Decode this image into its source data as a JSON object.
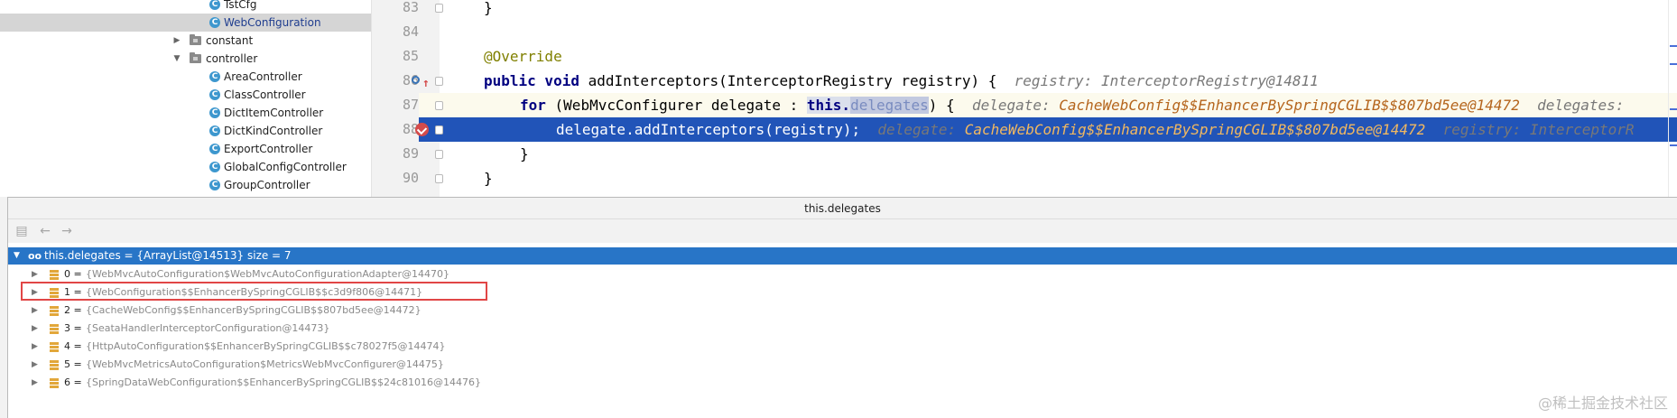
{
  "tree": {
    "items": [
      {
        "label": "TstCfg",
        "type": "class",
        "expanded": null,
        "selected": false
      },
      {
        "label": "WebConfiguration",
        "type": "class",
        "expanded": null,
        "selected": true
      },
      {
        "label": "constant",
        "type": "package",
        "expanded": false,
        "selected": false
      },
      {
        "label": "controller",
        "type": "package",
        "expanded": true,
        "selected": false
      },
      {
        "label": "AreaController",
        "type": "class",
        "expanded": null,
        "selected": false
      },
      {
        "label": "ClassController",
        "type": "class",
        "expanded": null,
        "selected": false
      },
      {
        "label": "DictItemController",
        "type": "class",
        "expanded": null,
        "selected": false
      },
      {
        "label": "DictKindController",
        "type": "class",
        "expanded": null,
        "selected": false
      },
      {
        "label": "ExportController",
        "type": "class",
        "expanded": null,
        "selected": false
      },
      {
        "label": "GlobalConfigController",
        "type": "class",
        "expanded": null,
        "selected": false
      },
      {
        "label": "GroupController",
        "type": "class",
        "expanded": null,
        "selected": false
      }
    ]
  },
  "editor": {
    "lines": [
      {
        "num": "83",
        "code": "}"
      },
      {
        "num": "84",
        "code": ""
      },
      {
        "num": "85",
        "annotation": "@Override"
      },
      {
        "num": "86",
        "kw": "public void",
        "code": " addInterceptors(InterceptorRegistry registry) {",
        "hint_key": "registry:",
        "hint_val": "InterceptorRegistry@14811"
      },
      {
        "num": "87",
        "kw": "for",
        "pre": " (WebMvcConfigurer delegate : ",
        "kw2": "this.",
        "field": "delegates",
        "post": ") {",
        "hint_key": "delegate:",
        "hint_val": "CacheWebConfig$$EnhancerBySpringCGLIB$$807bd5ee@14472",
        "hint_key2": "delegates:"
      },
      {
        "num": "88",
        "code": "delegate.addInterceptors(registry);",
        "hint_key": "delegate:",
        "hint_val": "CacheWebConfig$$EnhancerBySpringCGLIB$$807bd5ee@14472",
        "hint_key2": "registry:",
        "hint_val2": "InterceptorR"
      },
      {
        "num": "89",
        "code": "}"
      },
      {
        "num": "90",
        "code": "}"
      }
    ]
  },
  "popup": {
    "title": "this.delegates",
    "root": "this.delegates = {ArrayList@14513}  size = 7",
    "root_icon": "oo",
    "rows": [
      {
        "idx": "0 =",
        "value": "{WebMvcAutoConfiguration$WebMvcAutoConfigurationAdapter@14470}"
      },
      {
        "idx": "1 =",
        "value": "{WebConfiguration$$EnhancerBySpringCGLIB$$c3d9f806@14471}"
      },
      {
        "idx": "2 =",
        "value": "{CacheWebConfig$$EnhancerBySpringCGLIB$$807bd5ee@14472}"
      },
      {
        "idx": "3 =",
        "value": "{SeataHandlerInterceptorConfiguration@14473}"
      },
      {
        "idx": "4 =",
        "value": "{HttpAutoConfiguration$$EnhancerBySpringCGLIB$$c78027f5@14474}"
      },
      {
        "idx": "5 =",
        "value": "{WebMvcMetricsAutoConfiguration$MetricsWebMvcConfigurer@14475}"
      },
      {
        "idx": "6 =",
        "value": "{SpringDataWebConfiguration$$EnhancerBySpringCGLIB$$24c81016@14476}"
      }
    ]
  },
  "watermark": "@稀土掘金技术社区",
  "colors": {
    "selection_blue": "#2154b8",
    "tree_row_blue": "#2875c7",
    "highlight_red": "#e14646",
    "hint_value": "#b5651d"
  }
}
